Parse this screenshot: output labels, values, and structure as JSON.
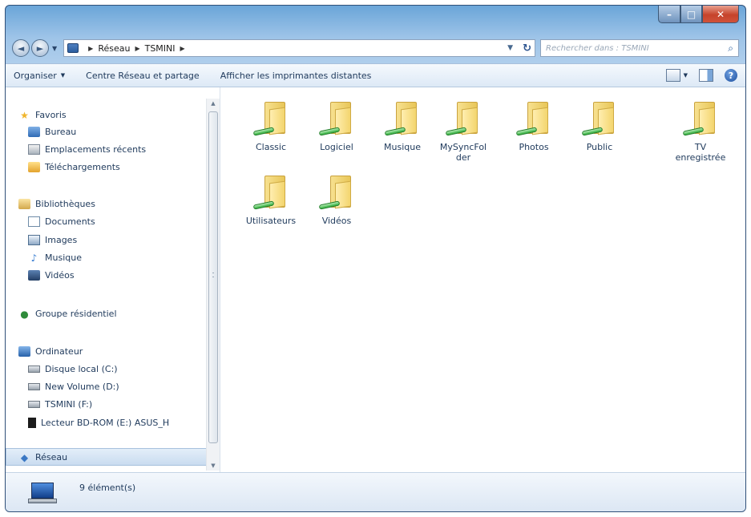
{
  "window": {
    "caption_buttons": {
      "minimize": "–",
      "maximize": "□",
      "close": "✕"
    }
  },
  "navbar": {
    "back_icon": "◄",
    "forward_icon": "►",
    "dropdown_icon": "▼",
    "address": {
      "crumbs": [
        "Réseau",
        "TSMINI"
      ],
      "dropdown_icon": "▼",
      "refresh_icon": "↻"
    },
    "search": {
      "placeholder": "Rechercher dans : TSMINI",
      "icon": "search-icon"
    }
  },
  "toolbar": {
    "organize": "Organiser",
    "network_center": "Centre Réseau et partage",
    "printers": "Afficher les imprimantes distantes"
  },
  "navpane": {
    "favorites": {
      "title": "Favoris",
      "items": [
        "Bureau",
        "Emplacements récents",
        "Téléchargements"
      ]
    },
    "libraries": {
      "title": "Bibliothèques",
      "items": [
        "Documents",
        "Images",
        "Musique",
        "Vidéos"
      ]
    },
    "homegroup": "Groupe résidentiel",
    "computer": {
      "title": "Ordinateur",
      "items": [
        "Disque local (C:)",
        "New Volume (D:)",
        "TSMINI (F:)",
        "Lecteur BD-ROM (E:) ASUS_H"
      ]
    },
    "network": "Réseau"
  },
  "files": [
    {
      "name": "Classic"
    },
    {
      "name": "Logiciel"
    },
    {
      "name": "Musique"
    },
    {
      "name": "MySyncFol der"
    },
    {
      "name": "Photos"
    },
    {
      "name": "Public"
    },
    {
      "name": "TV enregistrée"
    },
    {
      "name": "Utilisateurs"
    },
    {
      "name": "Vidéos"
    }
  ],
  "status": {
    "text": "9 élément(s)"
  },
  "colors": {
    "window_frame": "#6aa5d8",
    "close_button": "#c6432b",
    "folder": "#f3d56e"
  }
}
